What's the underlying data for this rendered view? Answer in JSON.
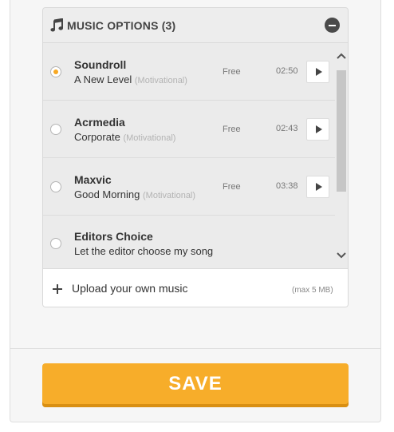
{
  "header": {
    "title": "MUSIC OPTIONS (3)",
    "icon": "music-note-icon",
    "collapse_icon": "minus-circle-icon"
  },
  "music_options": [
    {
      "name": "Soundroll",
      "track": "A New Level",
      "category": "(Motivational)",
      "price": "Free",
      "duration": "02:50",
      "selected": true
    },
    {
      "name": "Acrmedia",
      "track": "Corporate",
      "category": "(Motivational)",
      "price": "Free",
      "duration": "02:43",
      "selected": false
    },
    {
      "name": "Maxvic",
      "track": "Good Morning",
      "category": "(Motivational)",
      "price": "Free",
      "duration": "03:38",
      "selected": false
    },
    {
      "name": "Editors Choice",
      "track": "Let the editor choose my song",
      "selected": false
    }
  ],
  "upload": {
    "label": "Upload your own music",
    "limit": "(max 5 MB)",
    "icon": "plus-icon"
  },
  "save_label": "SAVE",
  "colors": {
    "accent": "#f7ad2a",
    "accent_shadow": "#d98f12",
    "selected_radio": "#f7a823"
  }
}
